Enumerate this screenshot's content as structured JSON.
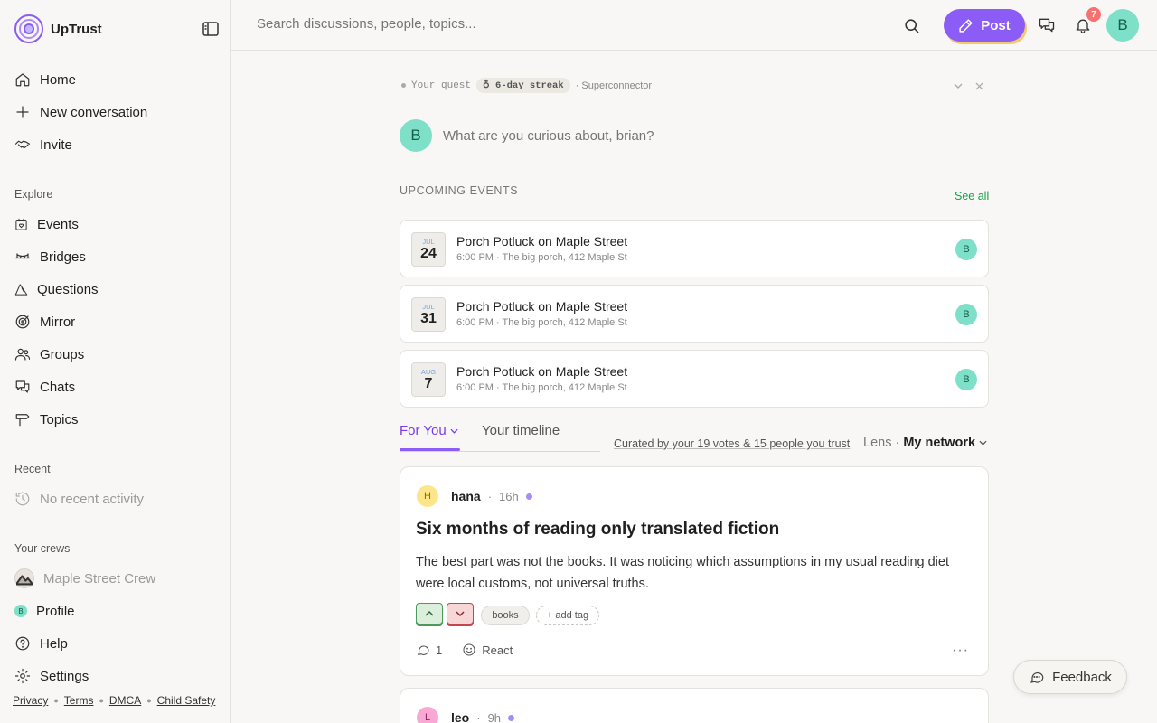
{
  "brand": {
    "name": "UpTrust"
  },
  "sidebar": {
    "primary": [
      {
        "label": "Home",
        "icon": "home-icon"
      },
      {
        "label": "New conversation",
        "icon": "plus-icon"
      },
      {
        "label": "Invite",
        "icon": "handshake-icon"
      }
    ],
    "explore_label": "Explore",
    "explore": [
      {
        "label": "Events",
        "icon": "calendar-heart-icon"
      },
      {
        "label": "Bridges",
        "icon": "bridge-icon"
      },
      {
        "label": "Questions",
        "icon": "question-triangle-icon"
      },
      {
        "label": "Mirror",
        "icon": "target-icon"
      },
      {
        "label": "Groups",
        "icon": "users-icon"
      },
      {
        "label": "Chats",
        "icon": "chat-bubbles-icon"
      },
      {
        "label": "Topics",
        "icon": "signpost-icon"
      }
    ],
    "recent_label": "Recent",
    "recent_empty": "No recent activity",
    "crews_label": "Your crews",
    "crew": "Maple Street Crew",
    "bottom": [
      {
        "label": "Profile",
        "icon": "profile-avatar-icon",
        "avatar_initial": "B"
      },
      {
        "label": "Help",
        "icon": "help-circle-icon"
      },
      {
        "label": "Settings",
        "icon": "gear-icon"
      }
    ],
    "footer": [
      "Privacy",
      "Terms",
      "DMCA",
      "Child Safety"
    ]
  },
  "topbar": {
    "search_placeholder": "Search discussions, people, topics...",
    "post_label": "Post",
    "notification_count": "7",
    "user_initial": "B"
  },
  "quest": {
    "label": "Your quest",
    "streak": "6-day streak",
    "goal": "· Superconnector"
  },
  "composer": {
    "avatar_initial": "B",
    "placeholder": "What are you curious about, brian?"
  },
  "events": {
    "title": "UPCOMING EVENTS",
    "see_all": "See all",
    "items": [
      {
        "month": "JUL",
        "day": "24",
        "title": "Porch Potluck on Maple Street",
        "meta": "6:00 PM · The big porch, 412 Maple St",
        "attendee": "B"
      },
      {
        "month": "JUL",
        "day": "31",
        "title": "Porch Potluck on Maple Street",
        "meta": "6:00 PM · The big porch, 412 Maple St",
        "attendee": "B"
      },
      {
        "month": "AUG",
        "day": "7",
        "title": "Porch Potluck on Maple Street",
        "meta": "6:00 PM · The big porch, 412 Maple St",
        "attendee": "B"
      }
    ]
  },
  "feed": {
    "tabs": [
      "For You",
      "Your timeline"
    ],
    "active_tab": "For You",
    "curated": "Curated by your 19 votes & 15 people you trust",
    "lens_label": "Lens ·",
    "lens_value": "My network"
  },
  "posts": [
    {
      "initial": "H",
      "author": "hana",
      "time": "16h",
      "avatar_color": "#fde68a",
      "title": "Six months of reading only translated fiction",
      "body": "The best part was not the books. It was noticing which assumptions in my usual reading diet were local customs, not universal truths.",
      "tags": [
        "books"
      ],
      "add_tag": "+ add tag",
      "comments": "1",
      "react": "React"
    },
    {
      "initial": "L",
      "author": "leo",
      "time": "9h",
      "avatar_color": "#f9a8d4"
    }
  ],
  "feedback_label": "Feedback",
  "colors": {
    "accent": "#8b5cf6",
    "link_green": "#16a34a",
    "avatar_teal": "#7ee0c9"
  }
}
